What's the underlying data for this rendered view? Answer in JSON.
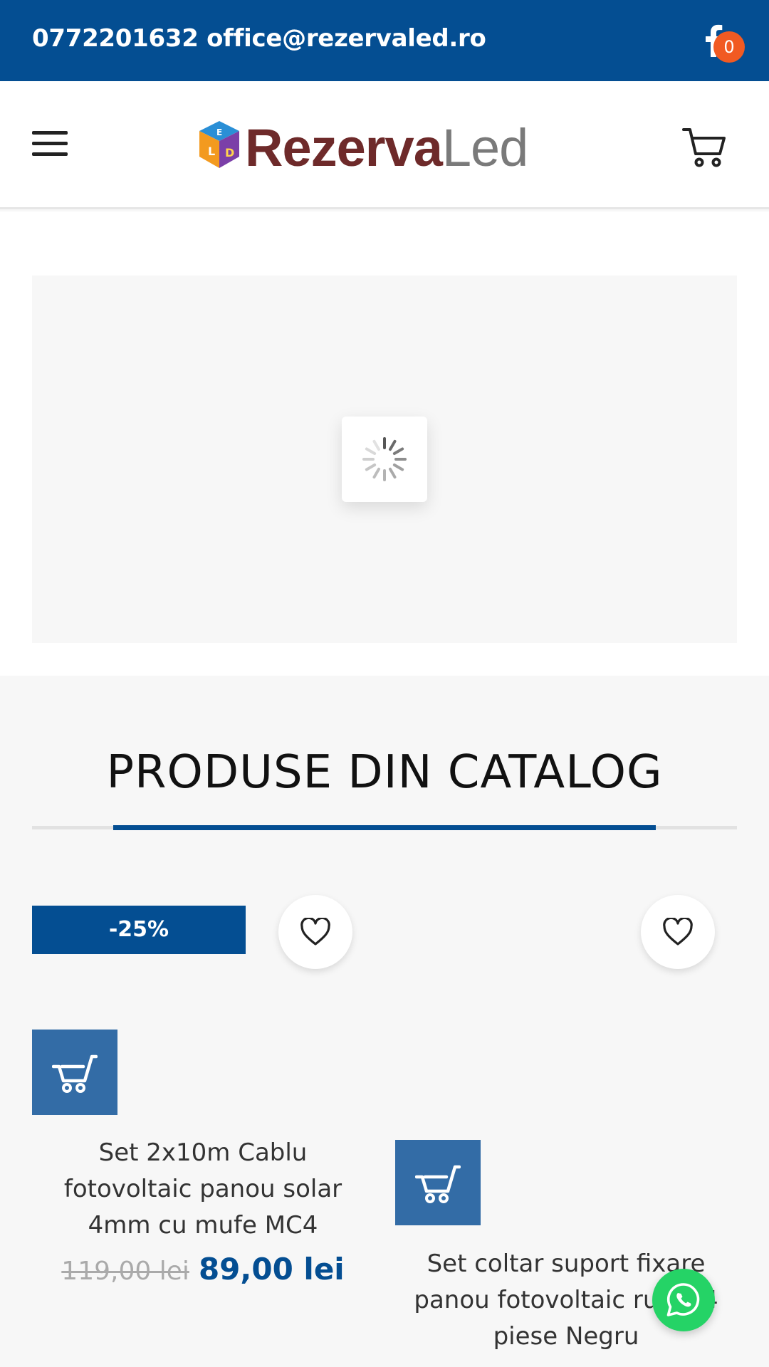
{
  "topbar": {
    "phone": "0772201632",
    "email": "office@rezervaled.ro"
  },
  "header": {
    "logo_bold": "Rezerva",
    "logo_light": "Led",
    "logo_cube_letters": "LED",
    "cart_count": "0"
  },
  "section": {
    "title": "PRODUSE DIN CATALOG"
  },
  "products": [
    {
      "badge": "-25%",
      "name": "Set 2x10m Cablu fotovoltaic panou solar 4mm cu mufe MC4",
      "old_price": "119,00 lei",
      "price": "89,00 lei"
    },
    {
      "name": "Set coltar suport fixare panou fotovoltaic rulou 4 piese Negru"
    }
  ],
  "colors": {
    "brand_blue": "#044e92",
    "button_blue": "#336ca6",
    "badge_orange": "#f15a22",
    "whatsapp_green": "#25d366"
  },
  "icons": [
    "facebook-icon",
    "menu-icon",
    "cart-icon",
    "loading-spinner-icon",
    "heart-icon",
    "add-to-cart-icon",
    "whatsapp-icon"
  ]
}
